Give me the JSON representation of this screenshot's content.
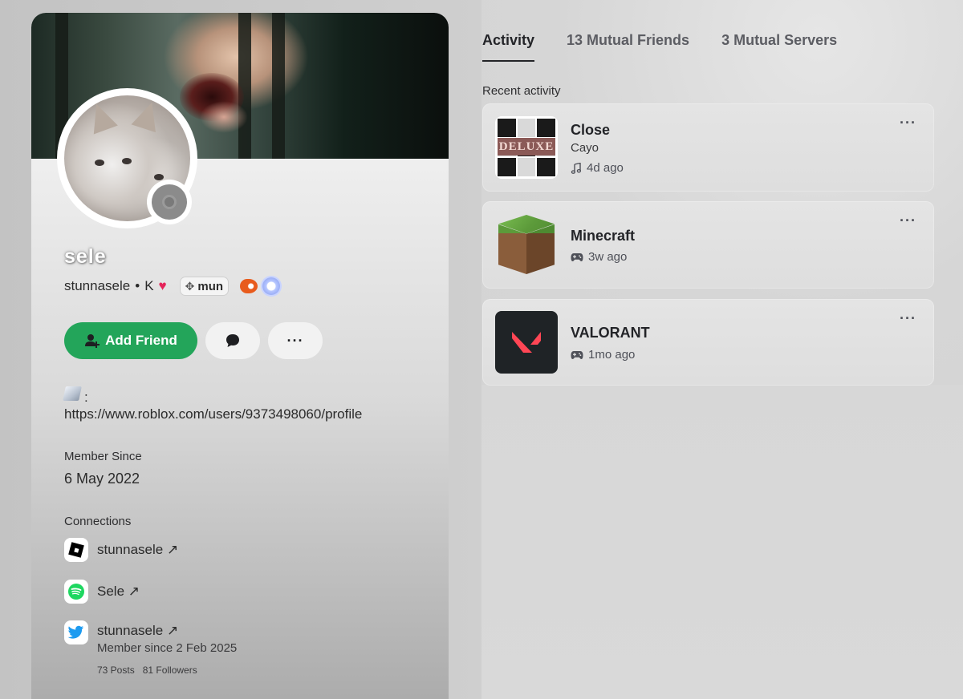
{
  "profile": {
    "display_name": "sele",
    "username": "stunnasele",
    "separator": "•",
    "pronoun_text": "K",
    "heart": "♥",
    "tag": "mun",
    "tag_glyph": "✥",
    "buttons": {
      "add_friend": "Add Friend",
      "more": "···"
    },
    "bio": {
      "colon": ":",
      "link": "https://www.roblox.com/users/9373498060/profile"
    },
    "member_since_label": "Member Since",
    "member_since_date": "6 May 2022",
    "connections_label": "Connections",
    "connections": [
      {
        "service": "roblox",
        "name": "stunnasele ↗"
      },
      {
        "service": "spotify",
        "name": "Sele ↗"
      },
      {
        "service": "twitter",
        "name": "stunnasele ↗",
        "sub": "Member since 2 Feb 2025",
        "posts": "73 Posts",
        "followers": "81 Followers"
      }
    ]
  },
  "tabs": [
    {
      "label": "Activity",
      "active": true
    },
    {
      "label": "13 Mutual Friends",
      "active": false
    },
    {
      "label": "3 Mutual Servers",
      "active": false
    }
  ],
  "recent_activity_label": "Recent activity",
  "activities": [
    {
      "title": "Close",
      "subtitle": "Cayo",
      "time": "4d ago",
      "icon": "music-note-icon",
      "art_text": "DELUXE",
      "menu": "···"
    },
    {
      "title": "Minecraft",
      "time": "3w ago",
      "icon": "gamepad-icon",
      "menu": "···"
    },
    {
      "title": "VALORANT",
      "time": "1mo ago",
      "icon": "gamepad-icon",
      "menu": "···"
    }
  ],
  "colors": {
    "primary_green": "#23a55a",
    "heart_pink": "#e5255a",
    "badge_orange": "#e85b1c",
    "valorant_red": "#ff4655"
  }
}
